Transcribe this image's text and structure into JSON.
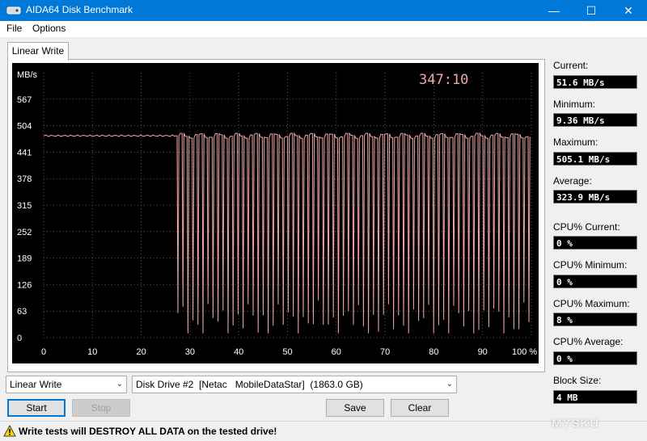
{
  "window": {
    "title": "AIDA64 Disk Benchmark",
    "minimize_glyph": "—",
    "maximize_glyph": "☐",
    "close_glyph": "✕"
  },
  "menu": {
    "file": "File",
    "options": "Options"
  },
  "tab": {
    "label": "Linear Write"
  },
  "chart_data": {
    "type": "line",
    "ylabel": "MB/s",
    "timer": "347:10",
    "y_ticks": [
      "567",
      "504",
      "441",
      "378",
      "315",
      "252",
      "189",
      "126",
      "63",
      "0"
    ],
    "x_ticks": [
      "0",
      "10",
      "20",
      "30",
      "40",
      "50",
      "60",
      "70",
      "80",
      "90",
      "100 %"
    ],
    "xlim": [
      0,
      100
    ],
    "ylim": [
      0,
      630
    ],
    "grid": true,
    "line_color": "#f0a8a8",
    "background": "#000000",
    "series": [
      {
        "segments": [
          {
            "x_start": 0,
            "x_end": 27,
            "value": 480
          },
          {
            "x_start": 27,
            "x_end": 100,
            "pattern": "oscillating",
            "high": 480,
            "low": 40
          }
        ]
      }
    ]
  },
  "stats": {
    "current_label": "Current:",
    "current_value": "51.6 MB/s",
    "minimum_label": "Minimum:",
    "minimum_value": "9.36 MB/s",
    "maximum_label": "Maximum:",
    "maximum_value": "505.1 MB/s",
    "average_label": "Average:",
    "average_value": "323.9 MB/s",
    "cpu_current_label": "CPU% Current:",
    "cpu_current_value": "0 %",
    "cpu_minimum_label": "CPU% Minimum:",
    "cpu_minimum_value": "0 %",
    "cpu_maximum_label": "CPU% Maximum:",
    "cpu_maximum_value": "8 %",
    "cpu_average_label": "CPU% Average:",
    "cpu_average_value": "0 %",
    "block_size_label": "Block Size:",
    "block_size_value": "4 MB"
  },
  "controls": {
    "test_select": "Linear Write",
    "drive_select": "Disk Drive #2  [Netac   MobileDataStar]  (1863.0 GB)",
    "start": "Start",
    "stop": "Stop",
    "save": "Save",
    "clear": "Clear"
  },
  "status": {
    "warning": "Write tests will DESTROY ALL DATA on the tested drive!",
    "watermark": "MYSKU"
  }
}
